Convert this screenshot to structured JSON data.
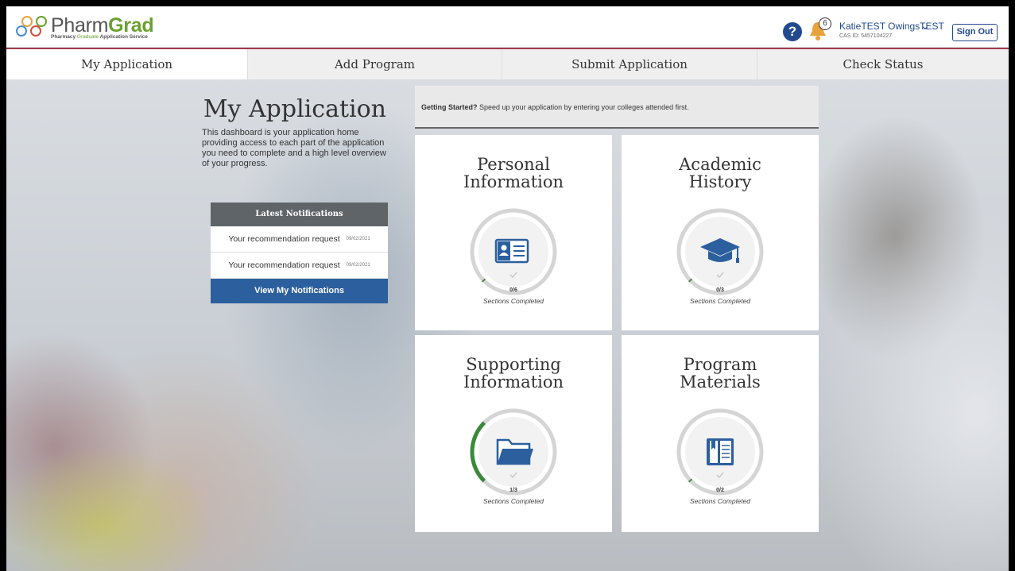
{
  "header": {
    "logo_word_a": "Pharm",
    "logo_word_b": "Grad",
    "logo_sub_a": "Pharmacy ",
    "logo_sub_b": "Graduate",
    "logo_sub_c": " Application Service",
    "help_icon": "?",
    "notification_count": "6",
    "user_name": "KatieTEST OwingsTEST",
    "cas_id": "CAS ID: 5457104227",
    "sign_out": "Sign Out"
  },
  "tabs": [
    {
      "label": "My Application",
      "active": true
    },
    {
      "label": "Add Program",
      "active": false
    },
    {
      "label": "Submit Application",
      "active": false
    },
    {
      "label": "Check Status",
      "active": false
    }
  ],
  "intro": {
    "title": "My Application",
    "description": "This dashboard is your application home providing access to each part of the application you need to complete and a high level overview of your progress."
  },
  "notifications": {
    "heading": "Latest Notifications",
    "items": [
      {
        "text": "Your recommendation request",
        "date": "09/02/2021"
      },
      {
        "text": "Your recommendation request",
        "date": "09/02/2021"
      }
    ],
    "button": "View My Notifications"
  },
  "banner": {
    "bold": "Getting Started?",
    "text": " Speed up your application by entering your colleges attended first."
  },
  "cards": [
    {
      "title_1": "Personal",
      "title_2": "Information",
      "count": "0/6",
      "completed": 0,
      "total": 6,
      "icon": "id-card-icon",
      "label": "Sections Completed"
    },
    {
      "title_1": "Academic",
      "title_2": "History",
      "count": "0/3",
      "completed": 0,
      "total": 3,
      "icon": "graduation-cap-icon",
      "label": "Sections Completed"
    },
    {
      "title_1": "Supporting",
      "title_2": "Information",
      "count": "1/3",
      "completed": 1,
      "total": 3,
      "icon": "folder-icon",
      "label": "Sections Completed"
    },
    {
      "title_1": "Program",
      "title_2": "Materials",
      "count": "0/2",
      "completed": 0,
      "total": 2,
      "icon": "book-icon",
      "label": "Sections Completed"
    }
  ],
  "colors": {
    "brand_green": "#6aa12f",
    "brand_blue": "#2c5f9e",
    "accent_red": "#a3394a",
    "progress_green": "#3a8a3a"
  }
}
